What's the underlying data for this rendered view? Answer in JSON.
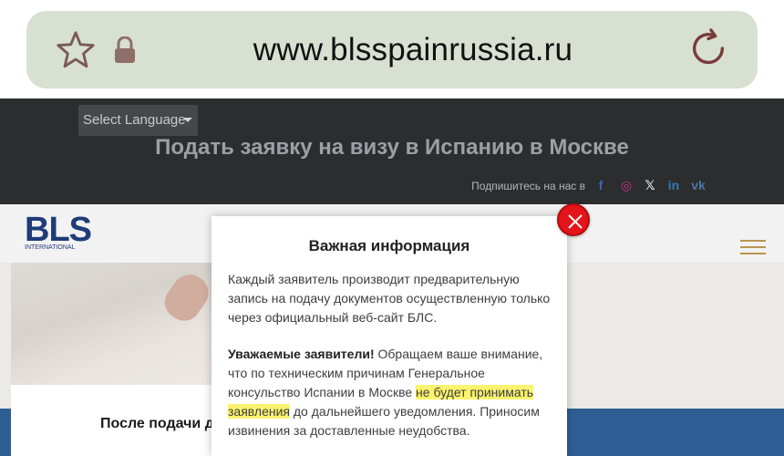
{
  "browser": {
    "url": "www.blsspainrussia.ru"
  },
  "header": {
    "language_select": "Select Language",
    "title": "Подать заявку на визу в Испанию в Москве",
    "subscribe_label": "Подпишитесь на нас в",
    "social": [
      {
        "name": "facebook-icon",
        "glyph": "f",
        "color": "#4267b2"
      },
      {
        "name": "instagram-icon",
        "glyph": "◎",
        "color": "#c1358a"
      },
      {
        "name": "x-icon",
        "glyph": "𝕏",
        "color": "#e8e8e8"
      },
      {
        "name": "linkedin-icon",
        "glyph": "in",
        "color": "#2f7fb8"
      },
      {
        "name": "vk-icon",
        "glyph": "vk",
        "color": "#4a76a8"
      }
    ]
  },
  "nav": {
    "logo_text": "BLS",
    "logo_subtext": "INTERNATIONAL"
  },
  "page": {
    "card_title": "После подачи д"
  },
  "modal": {
    "title": "Важная информация",
    "p1": "Каждый заявитель производит предварительную запись на подачу документов осуществленную только через официальный веб-сайт БЛС.",
    "p2_bold": "Уважаемые заявители!",
    "p2_a": " Обращаем ваше внимание, что по техническим причинам Генеральное консульство Испании в Москве ",
    "p2_highlight": "не будет принимать заявления",
    "p2_b": " до дальнейшего уведомления. Приносим извинения за доставленные неудобства."
  },
  "colors": {
    "address_bar": "#d7e0d1",
    "header_bg": "#2b2d2f",
    "close_button": "#e3141a",
    "highlight": "#fbf36e",
    "logo": "#1f3b78"
  }
}
